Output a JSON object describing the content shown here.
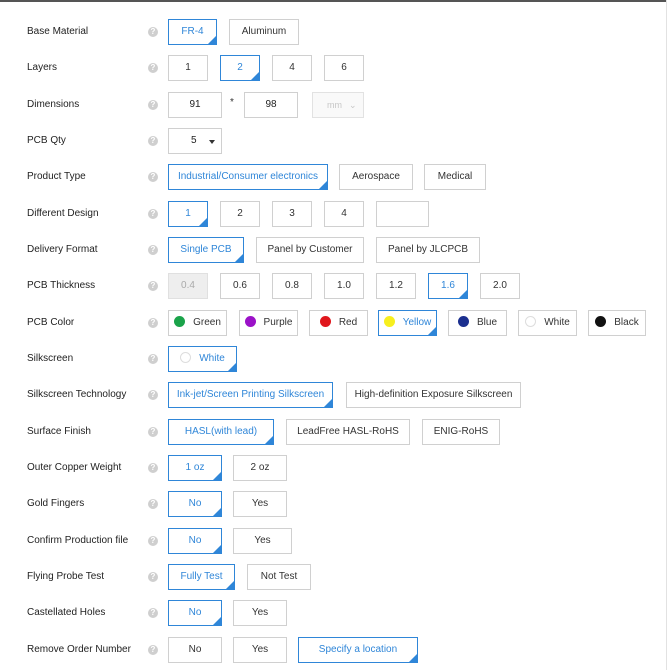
{
  "help_glyph": "?",
  "colors": {
    "accent": "#2f86d8",
    "border": "#d0d0d0",
    "help_bg": "#cfcfcf"
  },
  "base_material": {
    "label": "Base Material",
    "options": [
      "FR-4",
      "Aluminum"
    ],
    "selected": "FR-4"
  },
  "layers": {
    "label": "Layers",
    "options": [
      "1",
      "2",
      "4",
      "6"
    ],
    "selected": "2"
  },
  "dimensions": {
    "label": "Dimensions",
    "width": "91",
    "separator": "*",
    "height": "98",
    "unit": "mm"
  },
  "pcb_qty": {
    "label": "PCB Qty",
    "value": "5"
  },
  "product_type": {
    "label": "Product Type",
    "options": [
      "Industrial/Consumer electronics",
      "Aerospace",
      "Medical"
    ],
    "selected": "Industrial/Consumer electronics"
  },
  "different_design": {
    "label": "Different Design",
    "options": [
      "1",
      "2",
      "3",
      "4"
    ],
    "custom_value": "",
    "selected": "1"
  },
  "delivery_format": {
    "label": "Delivery Format",
    "options": [
      "Single PCB",
      "Panel by Customer",
      "Panel by JLCPCB"
    ],
    "selected": "Single PCB"
  },
  "pcb_thickness": {
    "label": "PCB Thickness",
    "options": [
      "0.4",
      "0.6",
      "0.8",
      "1.0",
      "1.2",
      "1.6",
      "2.0"
    ],
    "disabled": [
      "0.4"
    ],
    "selected": "1.6"
  },
  "pcb_color": {
    "label": "PCB Color",
    "options": [
      {
        "name": "Green",
        "color": "#1aa34a"
      },
      {
        "name": "Purple",
        "color": "#9b12c8"
      },
      {
        "name": "Red",
        "color": "#e0161c"
      },
      {
        "name": "Yellow",
        "color": "#f7ef1e"
      },
      {
        "name": "Blue",
        "color": "#1b2f8f"
      },
      {
        "name": "White",
        "color": "#ffffff"
      },
      {
        "name": "Black",
        "color": "#111111"
      }
    ],
    "selected": "Yellow"
  },
  "silkscreen": {
    "label": "Silkscreen",
    "value": "White",
    "dot_color": "#ffffff"
  },
  "silkscreen_technology": {
    "label": "Silkscreen Technology",
    "options": [
      "Ink-jet/Screen Printing Silkscreen",
      "High-definition Exposure Silkscreen"
    ],
    "selected": "Ink-jet/Screen Printing Silkscreen"
  },
  "surface_finish": {
    "label": "Surface Finish",
    "options": [
      "HASL(with lead)",
      "LeadFree HASL-RoHS",
      "ENIG-RoHS"
    ],
    "selected": "HASL(with lead)"
  },
  "outer_copper_weight": {
    "label": "Outer Copper Weight",
    "options": [
      "1 oz",
      "2 oz"
    ],
    "selected": "1 oz"
  },
  "gold_fingers": {
    "label": "Gold Fingers",
    "options": [
      "No",
      "Yes"
    ],
    "selected": "No"
  },
  "confirm_production_file": {
    "label": "Confirm Production file",
    "options": [
      "No",
      "Yes"
    ],
    "selected": "No"
  },
  "flying_probe_test": {
    "label": "Flying Probe Test",
    "options": [
      "Fully Test",
      "Not Test"
    ],
    "selected": "Fully Test"
  },
  "castellated_holes": {
    "label": "Castellated Holes",
    "options": [
      "No",
      "Yes"
    ],
    "selected": "No"
  },
  "remove_order_number": {
    "label": "Remove Order Number",
    "options": [
      "No",
      "Yes",
      "Specify a location"
    ],
    "selected": "Specify a location"
  }
}
